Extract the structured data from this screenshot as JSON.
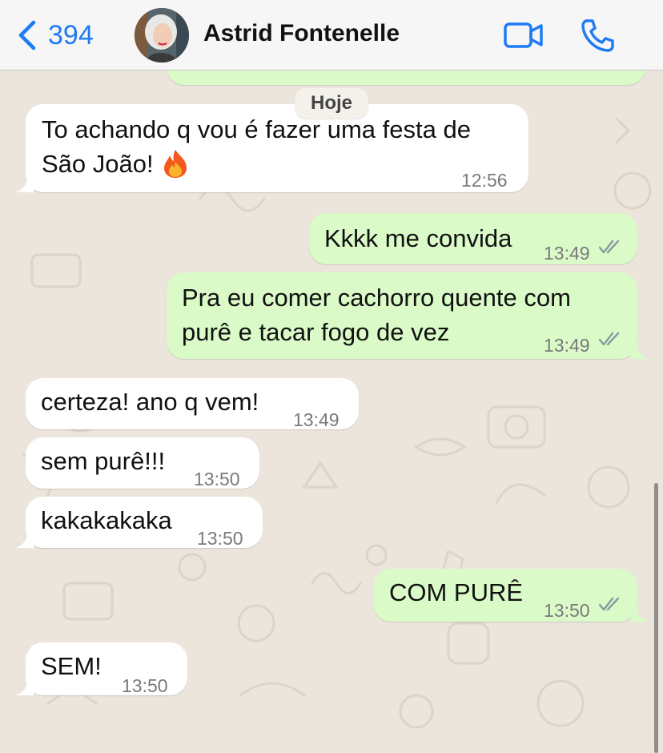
{
  "header": {
    "back_count": "394",
    "contact_name": "Astrid Fontenelle"
  },
  "colors": {
    "ios_blue": "#1f7af5",
    "incoming_bubble": "#ffffff",
    "outgoing_bubble": "#dafac8",
    "wallpaper": "#ece5dc",
    "read_ticks": "#8a9aa0"
  },
  "chat": {
    "day_separator": "Hoje",
    "messages": [
      {
        "direction": "in",
        "lines": [
          "To achando q vou é fazer uma festa de",
          "São João!"
        ],
        "emoji": "fire",
        "time": "12:56"
      },
      {
        "direction": "out",
        "lines": [
          "Kkkk me convida"
        ],
        "time": "13:49",
        "status": "read"
      },
      {
        "direction": "out",
        "lines": [
          "Pra eu comer cachorro quente com",
          "purê e tacar fogo de vez"
        ],
        "time": "13:49",
        "status": "read"
      },
      {
        "direction": "in",
        "lines": [
          "certeza! ano q vem!"
        ],
        "time": "13:49"
      },
      {
        "direction": "in",
        "lines": [
          "sem purê!!!"
        ],
        "time": "13:50"
      },
      {
        "direction": "in",
        "lines": [
          "kakakakaka"
        ],
        "time": "13:50"
      },
      {
        "direction": "out",
        "lines": [
          "COM PURÊ"
        ],
        "time": "13:50",
        "status": "read"
      },
      {
        "direction": "in",
        "lines": [
          "SEM!"
        ],
        "time": "13:50"
      }
    ]
  }
}
